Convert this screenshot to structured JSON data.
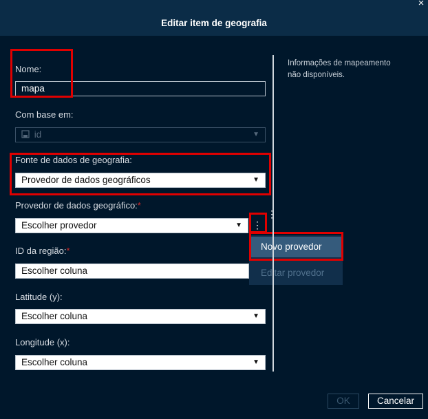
{
  "dialog": {
    "title": "Editar item de geografia",
    "close_symbol": "×"
  },
  "fields": {
    "name": {
      "label": "Nome:",
      "value": "mapa"
    },
    "based_on": {
      "label": "Com base em:",
      "value": "id"
    },
    "geo_source": {
      "label": "Fonte de dados de geografia:",
      "value": "Provedor de dados geográficos"
    },
    "geo_provider": {
      "label": "Provedor de dados geográfico:",
      "required": "*",
      "value": "Escolher provedor"
    },
    "region_id": {
      "label": "ID da região:",
      "required": "*",
      "value": "Escolher coluna"
    },
    "latitude": {
      "label": "Latitude (y):",
      "value": "Escolher coluna"
    },
    "longitude": {
      "label": "Longitude (x):",
      "value": "Escolher coluna"
    }
  },
  "info_panel": {
    "text": "Informações de mapeamento não disponíveis."
  },
  "provider_menu": {
    "items": [
      "Novo provedor",
      "Editar provedor"
    ]
  },
  "buttons": {
    "ok": "OK",
    "cancel": "Cancelar"
  },
  "colors": {
    "background": "#00172b",
    "header": "#0b2c47",
    "highlight": "#e00000",
    "menu_active": "#355b7c"
  }
}
